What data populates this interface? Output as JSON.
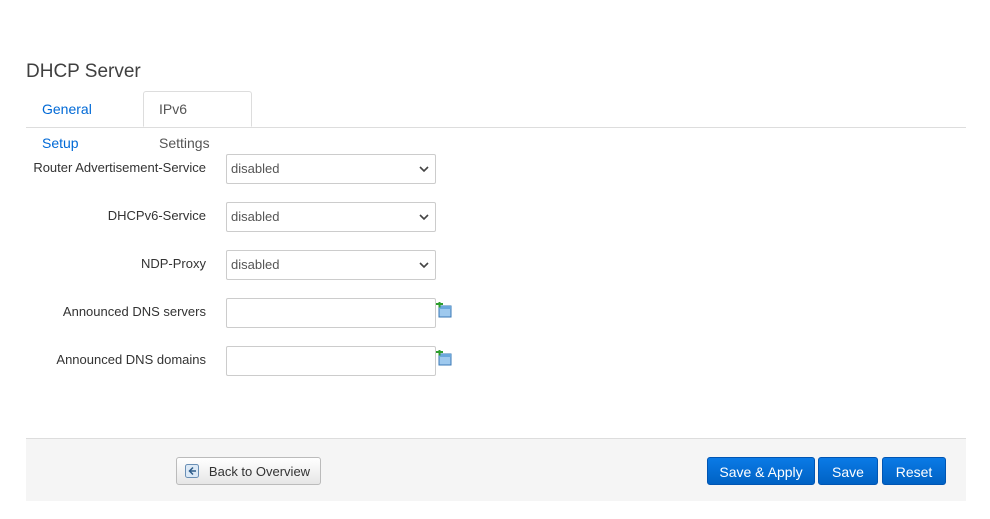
{
  "section": {
    "title": "DHCP Server"
  },
  "tabs": [
    {
      "label": "General Setup",
      "active": false
    },
    {
      "label": "IPv6 Settings",
      "active": true
    }
  ],
  "form": {
    "router_advertisement": {
      "label": "Router Advertisement-Service",
      "value": "disabled"
    },
    "dhcpv6": {
      "label": "DHCPv6-Service",
      "value": "disabled"
    },
    "ndp_proxy": {
      "label": "NDP-Proxy",
      "value": "disabled"
    },
    "dns_servers": {
      "label": "Announced DNS servers",
      "value": ""
    },
    "dns_domains": {
      "label": "Announced DNS domains",
      "value": ""
    }
  },
  "footer": {
    "back_label": "Back to Overview",
    "save_apply_label": "Save & Apply",
    "save_label": "Save",
    "reset_label": "Reset"
  },
  "colors": {
    "accent": "#0069d6",
    "button_blue": "#0a7ae6",
    "footer_bg": "#f5f5f5"
  }
}
